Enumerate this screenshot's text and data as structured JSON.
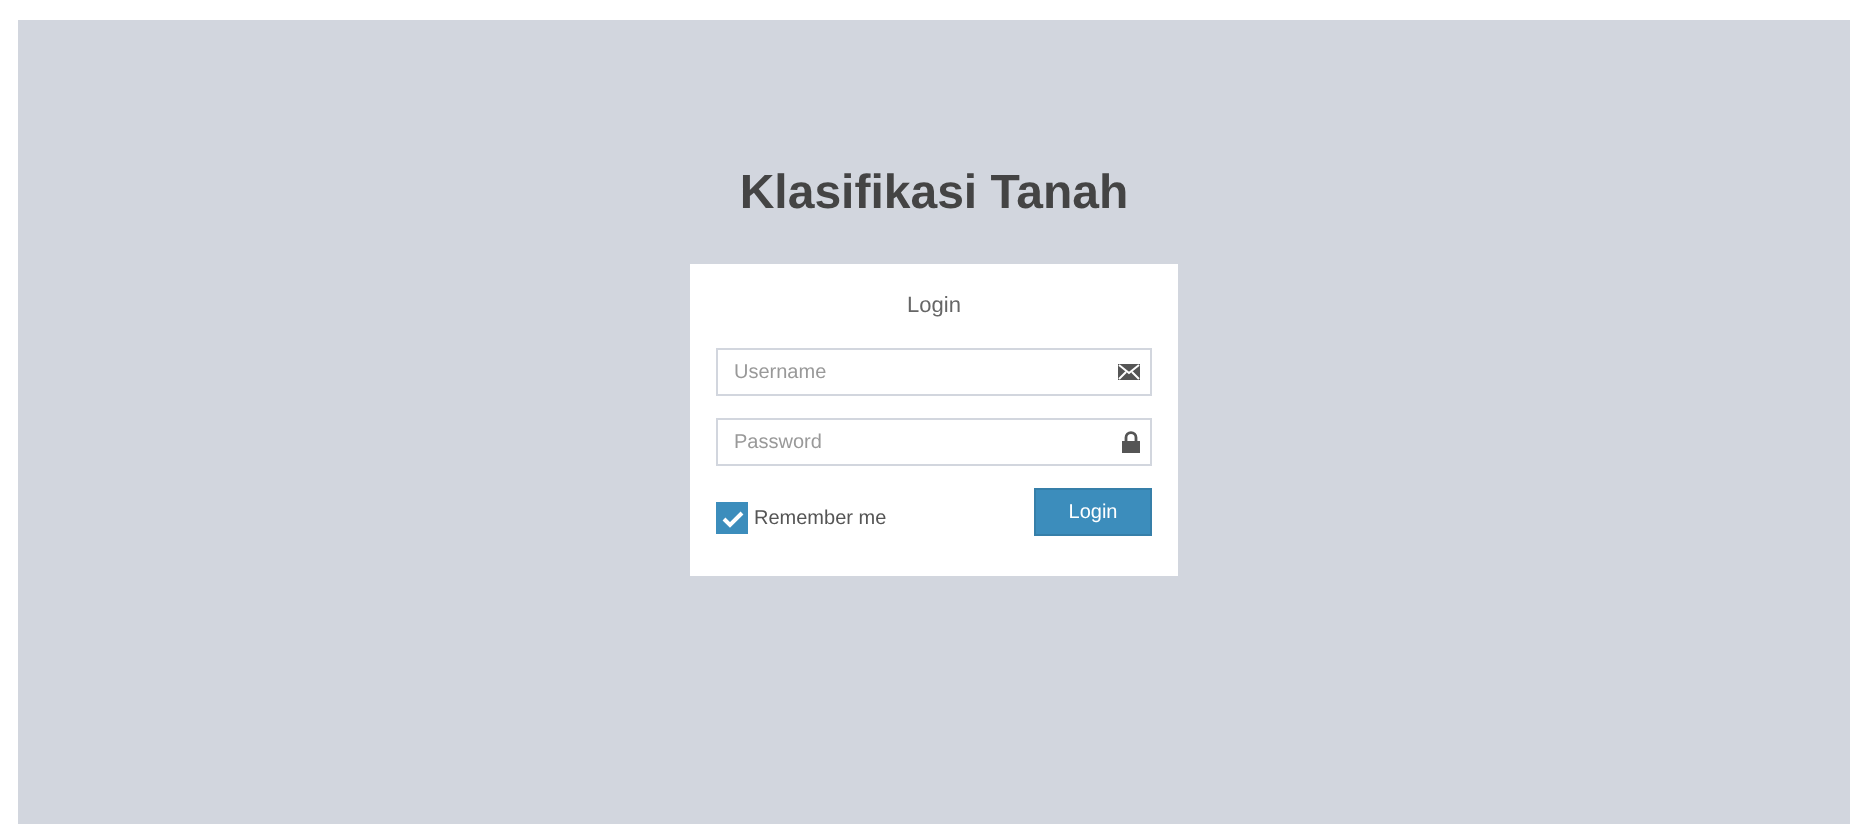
{
  "title": "Klasifikasi Tanah",
  "login_box": {
    "heading": "Login",
    "fields": [
      {
        "kind": "email",
        "placeholder": "Username"
      },
      {
        "kind": "password",
        "placeholder": "Password"
      }
    ],
    "remember": {
      "label": "Remember me",
      "checked": true
    },
    "button": "Login"
  }
}
